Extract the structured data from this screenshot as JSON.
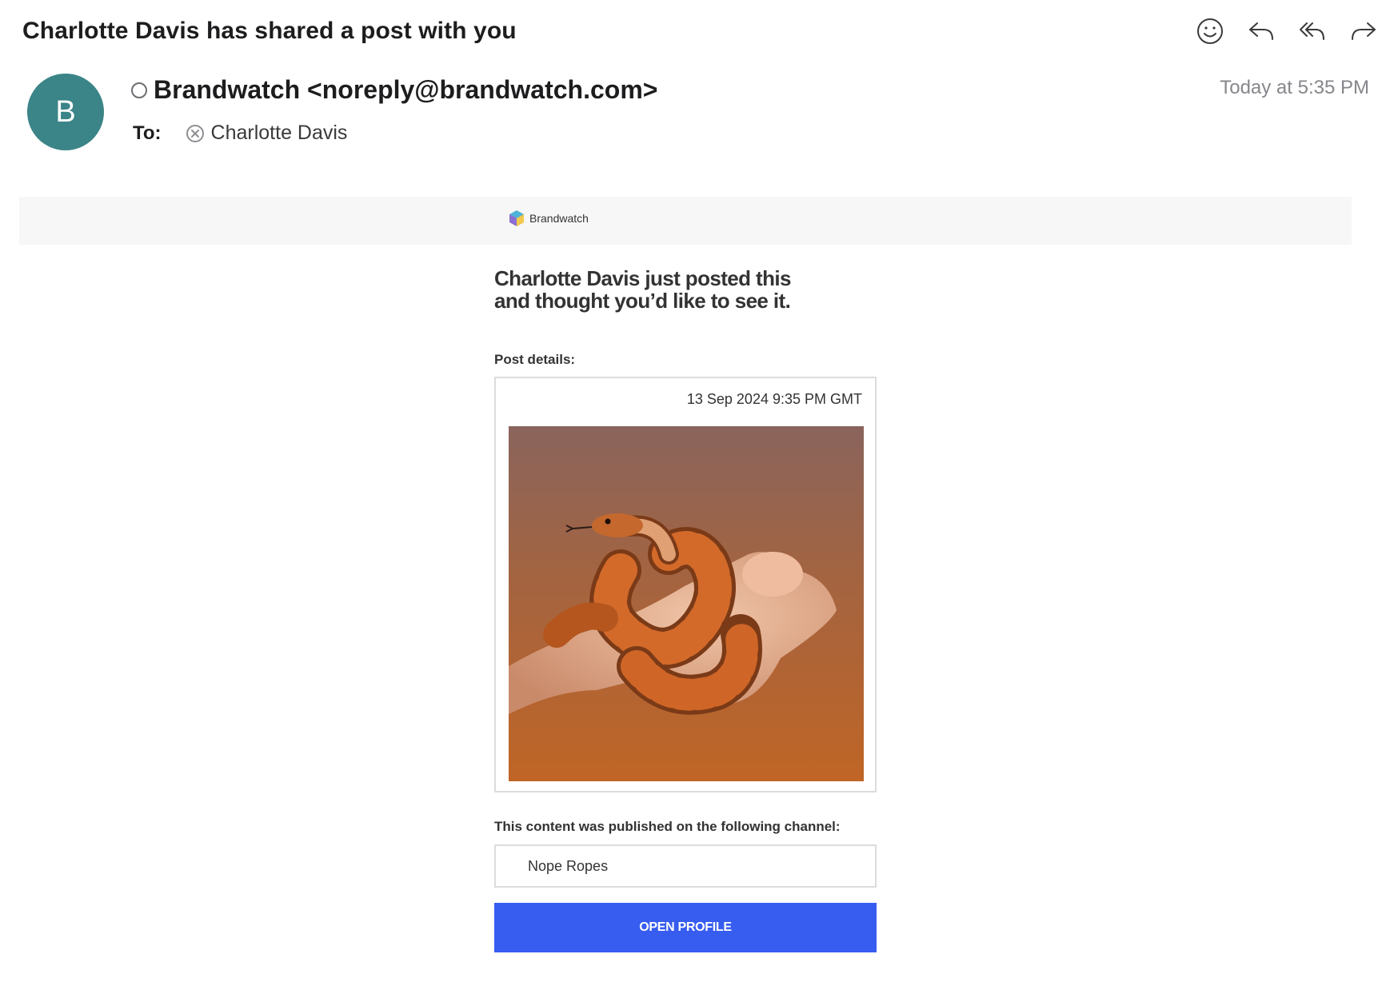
{
  "email": {
    "subject": "Charlotte Davis has shared a post with you",
    "avatar_initial": "B",
    "avatar_color": "#3b8487",
    "sender": "Brandwatch <noreply@brandwatch.com>",
    "to_label": "To:",
    "recipient": "Charlotte Davis",
    "date": "Today at 5:35 PM"
  },
  "toolbar": {
    "icons": [
      "emoji-icon",
      "reply-icon",
      "reply-all-icon",
      "forward-icon"
    ]
  },
  "body": {
    "brand_name": "Brandwatch",
    "headline_line1": "Charlotte Davis just posted this",
    "headline_line2": "and thought you’d like to see it.",
    "post_details_label": "Post details:",
    "post_date": "13 Sep 2024 9:35 PM GMT",
    "channel_label": "This content was published on the following channel:",
    "channel_name": "Nope Ropes",
    "open_button": "OPEN PROFILE",
    "button_color": "#375cf0"
  }
}
